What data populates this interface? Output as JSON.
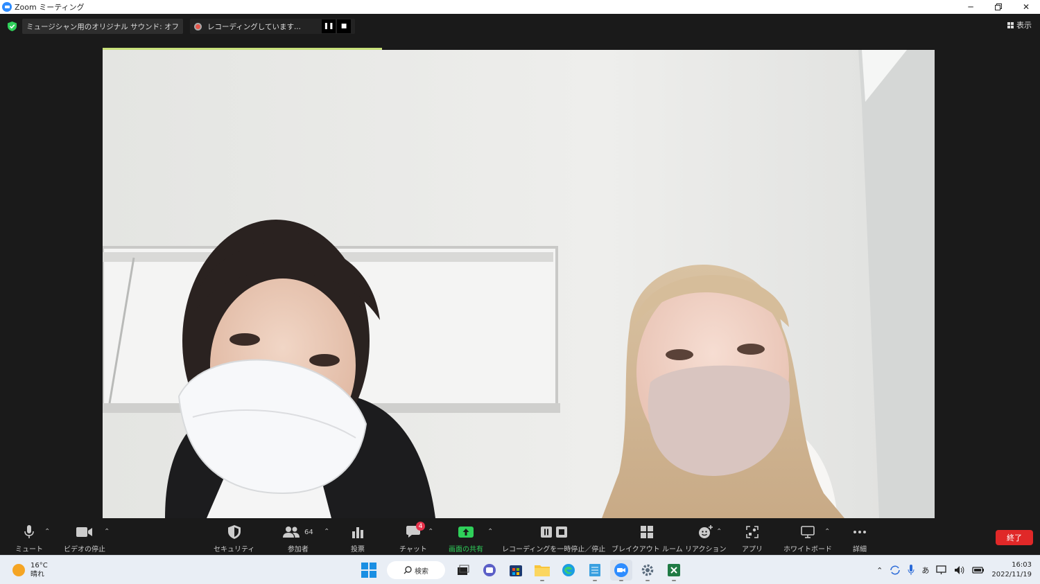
{
  "window": {
    "title": "Zoom ミーティング"
  },
  "topbar": {
    "sound_label": "ミュージシャン用のオリジナル サウンド: オフ",
    "recording_label": "レコーディングしています...",
    "view_label": "表示"
  },
  "toolbar": {
    "mute": "ミュート",
    "video": "ビデオの停止",
    "security": "セキュリティ",
    "participants": "参加者",
    "participants_count": "64",
    "polls": "投票",
    "chat": "チャット",
    "chat_badge": "4",
    "share": "画面の共有",
    "recording": "レコーディングを一時停止／停止",
    "breakout": "ブレイクアウト ルーム",
    "reactions": "リアクション",
    "apps": "アプリ",
    "whiteboard": "ホワイトボード",
    "more": "詳細",
    "end": "終了"
  },
  "taskbar": {
    "temperature": "16°C",
    "weather": "晴れ",
    "search": "検索",
    "ime": "あ",
    "time": "16:03",
    "date": "2022/11/19"
  },
  "colors": {
    "share_green": "#2fd05a",
    "end_red": "#e02828",
    "badge_red": "#e5324b",
    "zoom_blue": "#2d8cff"
  }
}
